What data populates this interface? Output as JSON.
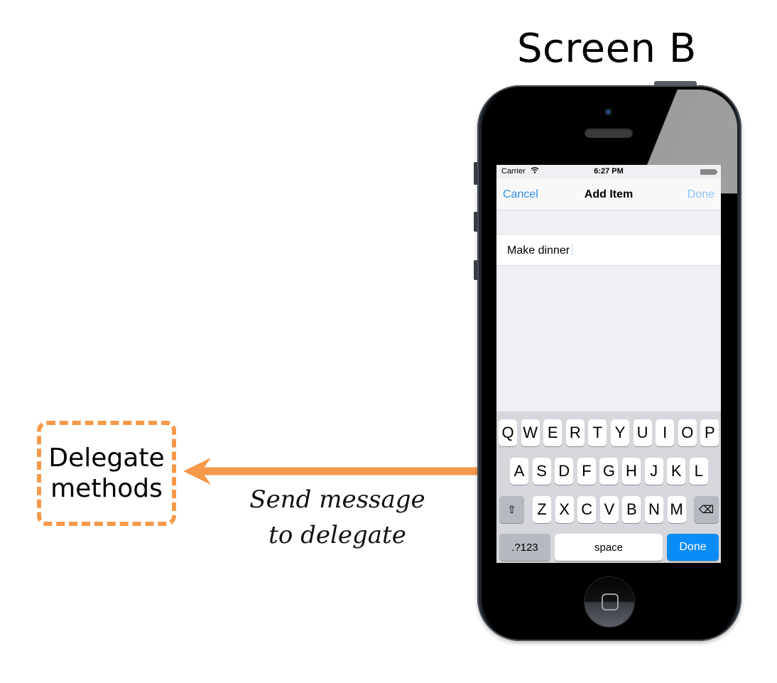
{
  "diagram": {
    "title": "Screen B",
    "delegate_box": {
      "line1": "Delegate",
      "line2": "methods"
    },
    "arrow": {
      "direction": "left",
      "color": "#f7994a"
    },
    "caption": {
      "line1": "Send message",
      "line2": "to delegate"
    },
    "accent_color": "#f7994a"
  },
  "phone": {
    "statusbar": {
      "carrier": "Carrier",
      "wifi_icon": "wifi-icon",
      "time": "6:27 PM",
      "battery_icon": "battery-icon"
    },
    "navbar": {
      "cancel_label": "Cancel",
      "title": "Add Item",
      "done_label": "Done"
    },
    "text_field": {
      "value": "Make dinner"
    },
    "keyboard": {
      "row1": [
        "Q",
        "W",
        "E",
        "R",
        "T",
        "Y",
        "U",
        "I",
        "O",
        "P"
      ],
      "row2": [
        "A",
        "S",
        "D",
        "F",
        "G",
        "H",
        "J",
        "K",
        "L"
      ],
      "row3": [
        "Z",
        "X",
        "C",
        "V",
        "B",
        "N",
        "M"
      ],
      "shift_icon": "⇧",
      "delete_icon": "⌫",
      "numbers_label": ".?123",
      "space_label": "space",
      "done_label": "Done"
    },
    "colors": {
      "tint": "#2f8ef0",
      "done_key": "#0a8cf8"
    }
  }
}
